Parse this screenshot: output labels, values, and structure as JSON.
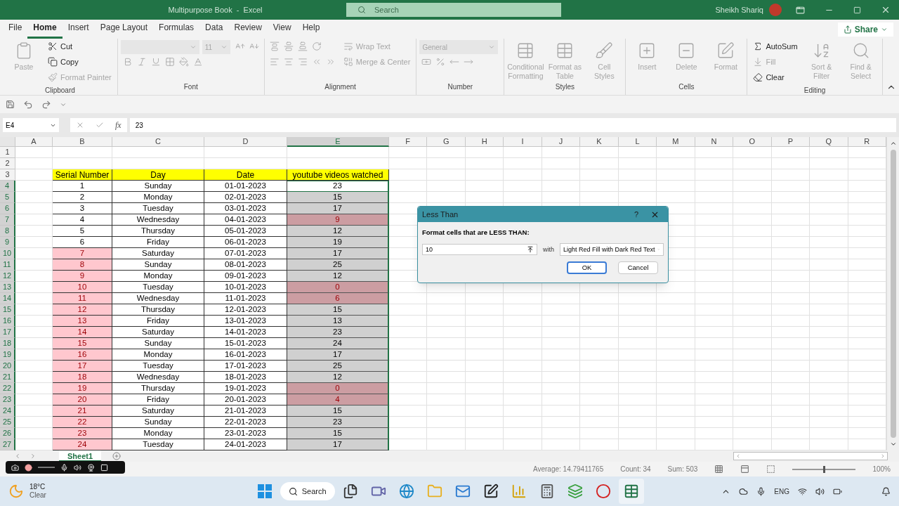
{
  "window": {
    "title": "Multipurpose Book  -  Excel",
    "search_placeholder": "Search",
    "user": "Sheikh Shariq"
  },
  "menu_tabs": [
    {
      "label": "File",
      "selected": false
    },
    {
      "label": "Home",
      "selected": true
    },
    {
      "label": "Insert",
      "selected": false
    },
    {
      "label": "Page Layout",
      "selected": false
    },
    {
      "label": "Formulas",
      "selected": false
    },
    {
      "label": "Data",
      "selected": false
    },
    {
      "label": "Review",
      "selected": false
    },
    {
      "label": "View",
      "selected": false
    },
    {
      "label": "Help",
      "selected": false
    }
  ],
  "share": "Share",
  "ribbon": [
    {
      "label": "Clipboard",
      "columns": [
        [
          [
            {
              "kind": "large",
              "label": "Paste",
              "disabled": true
            }
          ]
        ],
        [
          [
            {
              "kind": "small",
              "label": "Cut",
              "disabled": false
            }
          ],
          [
            {
              "kind": "small",
              "label": "Copy",
              "disabled": false
            }
          ],
          [
            {
              "kind": "small",
              "label": "Format Painter",
              "disabled": true
            }
          ]
        ]
      ]
    },
    {
      "label": "Font",
      "columns": [
        [
          [
            {
              "kind": "wide-field",
              "disabled": true
            },
            {
              "kind": "narrow-field",
              "value": "11",
              "disabled": true
            },
            {
              "kind": "icon",
              "disabled": true
            },
            {
              "kind": "icon",
              "disabled": true
            }
          ],
          [
            {
              "kind": "icon",
              "disabled": true
            },
            {
              "kind": "icon",
              "disabled": true
            },
            {
              "kind": "icon",
              "disabled": true
            },
            {
              "kind": "icon",
              "disabled": true
            },
            {
              "kind": "icon",
              "disabled": true
            },
            {
              "kind": "icon",
              "disabled": true
            }
          ]
        ]
      ]
    },
    {
      "label": "Alignment",
      "columns": [
        [
          [
            {
              "kind": "icon",
              "disabled": true
            },
            {
              "kind": "icon",
              "disabled": true
            },
            {
              "kind": "icon",
              "disabled": true
            },
            {
              "kind": "icon",
              "disabled": true
            }
          ],
          [
            {
              "kind": "icon",
              "disabled": true
            },
            {
              "kind": "icon",
              "disabled": true
            },
            {
              "kind": "icon",
              "disabled": true
            },
            {
              "kind": "icon",
              "disabled": true
            },
            {
              "kind": "icon",
              "disabled": true
            }
          ]
        ],
        [
          [
            {
              "kind": "small",
              "label": "Wrap Text",
              "disabled": true
            }
          ],
          [
            {
              "kind": "small",
              "label": "Merge & Center",
              "disabled": true
            }
          ]
        ]
      ]
    },
    {
      "label": "Number",
      "columns": [
        [
          [
            {
              "kind": "wide-field",
              "value": "General",
              "disabled": true
            }
          ],
          [
            {
              "kind": "icon",
              "disabled": true
            },
            {
              "kind": "icon",
              "disabled": true
            },
            {
              "kind": "icon",
              "disabled": true
            },
            {
              "kind": "icon",
              "disabled": true
            }
          ]
        ]
      ]
    },
    {
      "label": "Styles",
      "columns": [
        [
          [
            {
              "kind": "large",
              "label": "Conditional Formatting",
              "disabled": true
            }
          ]
        ],
        [
          [
            {
              "kind": "large",
              "label": "Format as Table",
              "disabled": true
            }
          ]
        ],
        [
          [
            {
              "kind": "large",
              "label": "Cell Styles",
              "disabled": true
            }
          ]
        ]
      ]
    },
    {
      "label": "Cells",
      "columns": [
        [
          [
            {
              "kind": "large",
              "label": "Insert",
              "disabled": true
            }
          ]
        ],
        [
          [
            {
              "kind": "large",
              "label": "Delete",
              "disabled": true
            }
          ]
        ],
        [
          [
            {
              "kind": "large",
              "label": "Format",
              "disabled": true
            }
          ]
        ]
      ]
    },
    {
      "label": "Editing",
      "columns": [
        [
          [
            {
              "kind": "small",
              "label": "AutoSum",
              "disabled": false
            }
          ],
          [
            {
              "kind": "small",
              "label": "Fill",
              "disabled": true
            }
          ],
          [
            {
              "kind": "small",
              "label": "Clear",
              "disabled": false
            }
          ]
        ],
        [
          [
            {
              "kind": "large",
              "label": "Sort & Filter",
              "disabled": true
            }
          ]
        ],
        [
          [
            {
              "kind": "large",
              "label": "Find & Select",
              "disabled": true
            }
          ]
        ]
      ]
    }
  ],
  "formula_bar": {
    "name_box": "E4",
    "function_label": "fx",
    "value": "23"
  },
  "columns": [
    {
      "label": "A",
      "selected": false
    },
    {
      "label": "B",
      "selected": false
    },
    {
      "label": "C",
      "selected": false
    },
    {
      "label": "D",
      "selected": false
    },
    {
      "label": "E",
      "selected": true
    },
    {
      "label": "F",
      "selected": false
    },
    {
      "label": "G",
      "selected": false
    },
    {
      "label": "H",
      "selected": false
    },
    {
      "label": "I",
      "selected": false
    },
    {
      "label": "J",
      "selected": false
    },
    {
      "label": "K",
      "selected": false
    },
    {
      "label": "L",
      "selected": false
    },
    {
      "label": "M",
      "selected": false
    },
    {
      "label": "N",
      "selected": false
    },
    {
      "label": "O",
      "selected": false
    },
    {
      "label": "P",
      "selected": false
    },
    {
      "label": "Q",
      "selected": false
    },
    {
      "label": "R",
      "selected": false
    }
  ],
  "row_numbers": [
    {
      "label": "1",
      "selected": false
    },
    {
      "label": "2",
      "selected": false
    },
    {
      "label": "3",
      "selected": false
    },
    {
      "label": "4",
      "selected": true
    },
    {
      "label": "5",
      "selected": true
    },
    {
      "label": "6",
      "selected": true
    },
    {
      "label": "7",
      "selected": true
    },
    {
      "label": "8",
      "selected": true
    },
    {
      "label": "9",
      "selected": true
    },
    {
      "label": "10",
      "selected": true
    },
    {
      "label": "11",
      "selected": true
    },
    {
      "label": "12",
      "selected": true
    },
    {
      "label": "13",
      "selected": true
    },
    {
      "label": "14",
      "selected": true
    },
    {
      "label": "15",
      "selected": true
    },
    {
      "label": "16",
      "selected": true
    },
    {
      "label": "17",
      "selected": true
    },
    {
      "label": "18",
      "selected": true
    },
    {
      "label": "19",
      "selected": true
    },
    {
      "label": "20",
      "selected": true
    },
    {
      "label": "21",
      "selected": true
    },
    {
      "label": "22",
      "selected": true
    },
    {
      "label": "23",
      "selected": true
    },
    {
      "label": "24",
      "selected": true
    },
    {
      "label": "25",
      "selected": true
    },
    {
      "label": "26",
      "selected": true
    },
    {
      "label": "27",
      "selected": true
    }
  ],
  "table": {
    "header": [
      "Serial Number",
      "Day",
      "Date",
      "youtube videos watched"
    ],
    "rows": [
      {
        "serial": "1",
        "day": "Sunday",
        "date": "01-01-2023",
        "videos": "23",
        "serial_highlighted": false,
        "videos_highlighted": false,
        "selected": false
      },
      {
        "serial": "2",
        "day": "Monday",
        "date": "02-01-2023",
        "videos": "15",
        "serial_highlighted": false,
        "videos_highlighted": false,
        "selected": true
      },
      {
        "serial": "3",
        "day": "Tuesday",
        "date": "03-01-2023",
        "videos": "17",
        "serial_highlighted": false,
        "videos_highlighted": false,
        "selected": true
      },
      {
        "serial": "4",
        "day": "Wednesday",
        "date": "04-01-2023",
        "videos": "9",
        "serial_highlighted": false,
        "videos_highlighted": true,
        "selected": true
      },
      {
        "serial": "5",
        "day": "Thursday",
        "date": "05-01-2023",
        "videos": "12",
        "serial_highlighted": false,
        "videos_highlighted": false,
        "selected": true
      },
      {
        "serial": "6",
        "day": "Friday",
        "date": "06-01-2023",
        "videos": "19",
        "serial_highlighted": false,
        "videos_highlighted": false,
        "selected": true
      },
      {
        "serial": "7",
        "day": "Saturday",
        "date": "07-01-2023",
        "videos": "17",
        "serial_highlighted": true,
        "videos_highlighted": false,
        "selected": true
      },
      {
        "serial": "8",
        "day": "Sunday",
        "date": "08-01-2023",
        "videos": "25",
        "serial_highlighted": true,
        "videos_highlighted": false,
        "selected": true
      },
      {
        "serial": "9",
        "day": "Monday",
        "date": "09-01-2023",
        "videos": "12",
        "serial_highlighted": true,
        "videos_highlighted": false,
        "selected": true
      },
      {
        "serial": "10",
        "day": "Tuesday",
        "date": "10-01-2023",
        "videos": "0",
        "serial_highlighted": true,
        "videos_highlighted": true,
        "selected": true
      },
      {
        "serial": "11",
        "day": "Wednesday",
        "date": "11-01-2023",
        "videos": "6",
        "serial_highlighted": true,
        "videos_highlighted": true,
        "selected": true
      },
      {
        "serial": "12",
        "day": "Thursday",
        "date": "12-01-2023",
        "videos": "15",
        "serial_highlighted": true,
        "videos_highlighted": false,
        "selected": true
      },
      {
        "serial": "13",
        "day": "Friday",
        "date": "13-01-2023",
        "videos": "13",
        "serial_highlighted": true,
        "videos_highlighted": false,
        "selected": true
      },
      {
        "serial": "14",
        "day": "Saturday",
        "date": "14-01-2023",
        "videos": "23",
        "serial_highlighted": true,
        "videos_highlighted": false,
        "selected": true
      },
      {
        "serial": "15",
        "day": "Sunday",
        "date": "15-01-2023",
        "videos": "24",
        "serial_highlighted": true,
        "videos_highlighted": false,
        "selected": true
      },
      {
        "serial": "16",
        "day": "Monday",
        "date": "16-01-2023",
        "videos": "17",
        "serial_highlighted": true,
        "videos_highlighted": false,
        "selected": true
      },
      {
        "serial": "17",
        "day": "Tuesday",
        "date": "17-01-2023",
        "videos": "25",
        "serial_highlighted": true,
        "videos_highlighted": false,
        "selected": true
      },
      {
        "serial": "18",
        "day": "Wednesday",
        "date": "18-01-2023",
        "videos": "12",
        "serial_highlighted": true,
        "videos_highlighted": false,
        "selected": true
      },
      {
        "serial": "19",
        "day": "Thursday",
        "date": "19-01-2023",
        "videos": "0",
        "serial_highlighted": true,
        "videos_highlighted": true,
        "selected": true
      },
      {
        "serial": "20",
        "day": "Friday",
        "date": "20-01-2023",
        "videos": "4",
        "serial_highlighted": true,
        "videos_highlighted": true,
        "selected": true
      },
      {
        "serial": "21",
        "day": "Saturday",
        "date": "21-01-2023",
        "videos": "15",
        "serial_highlighted": true,
        "videos_highlighted": false,
        "selected": true
      },
      {
        "serial": "22",
        "day": "Sunday",
        "date": "22-01-2023",
        "videos": "23",
        "serial_highlighted": true,
        "videos_highlighted": false,
        "selected": true
      },
      {
        "serial": "23",
        "day": "Monday",
        "date": "23-01-2023",
        "videos": "15",
        "serial_highlighted": true,
        "videos_highlighted": false,
        "selected": true
      },
      {
        "serial": "24",
        "day": "Tuesday",
        "date": "24-01-2023",
        "videos": "17",
        "serial_highlighted": true,
        "videos_highlighted": false,
        "selected": true
      }
    ]
  },
  "dialog": {
    "title": "Less Than",
    "help": "?",
    "prompt": "Format cells that are LESS THAN:",
    "value": "10",
    "with_label": "with",
    "format": "Light Red Fill with Dark Red Text",
    "buttons": [
      {
        "label": "OK",
        "default": true
      },
      {
        "label": "Cancel",
        "default": false
      }
    ]
  },
  "sheet_tabs": [
    {
      "label": "Sheet1",
      "selected": true
    }
  ],
  "status_bar": {
    "average": "Average: 14.79411765",
    "count": "Count: 34",
    "sum": "Sum: 503",
    "zoom": "100%",
    "zoom_slider": {
      "level": 0.5
    }
  },
  "taskbar": {
    "temperature": "18°C",
    "weather": "Clear",
    "search": "Search",
    "language": "ENG"
  }
}
